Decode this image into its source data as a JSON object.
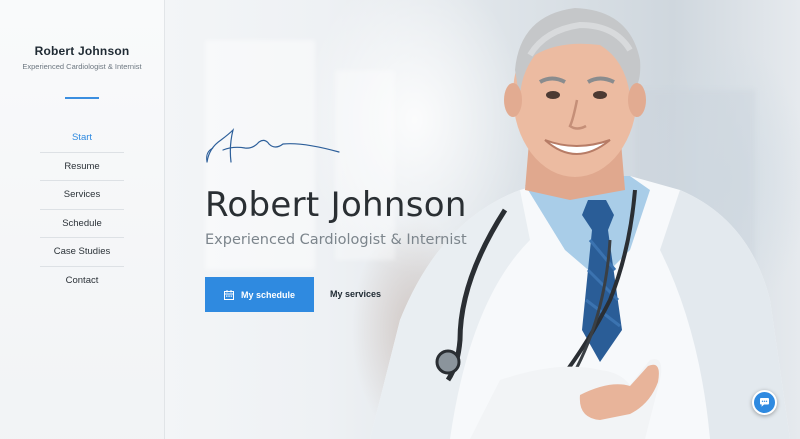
{
  "sidebar": {
    "name": "Robert Johnson",
    "subtitle": "Experienced Cardiologist & Internist",
    "menu": [
      {
        "label": "Start",
        "active": true
      },
      {
        "label": "Resume",
        "active": false
      },
      {
        "label": "Services",
        "active": false
      },
      {
        "label": "Schedule",
        "active": false
      },
      {
        "label": "Case Studies",
        "active": false
      },
      {
        "label": "Contact",
        "active": false
      }
    ]
  },
  "hero": {
    "name": "Robert Johnson",
    "subtitle": "Experienced Cardiologist & Internist",
    "primary_button": {
      "label": "My schedule",
      "icon": "calendar-icon"
    },
    "secondary_button": {
      "label": "My services"
    }
  },
  "chat_widget": {
    "icon": "chat-bubble-icon"
  },
  "colors": {
    "accent": "#2f8ae0",
    "text_dark": "#2a2f33",
    "text_muted": "#7c858c",
    "sidebar_bg": "#f6f7f9"
  }
}
